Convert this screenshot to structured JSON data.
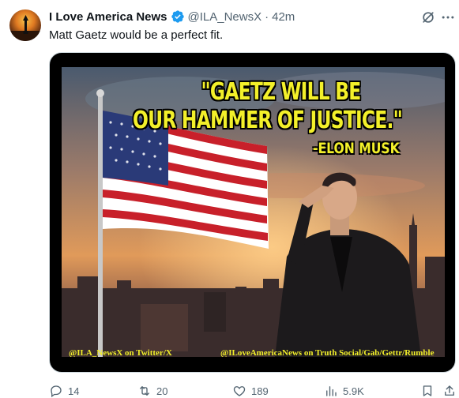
{
  "tweet": {
    "author_name": "I Love America News",
    "handle": "@ILA_NewsX",
    "separator": "·",
    "time": "42m",
    "text": "Matt Gaetz would be a perfect fit."
  },
  "image": {
    "quote_line1": "\"GAETZ WILL BE",
    "quote_line2": "OUR HAMMER OF JUSTICE.\"",
    "attribution": "-ELON MUSK",
    "watermark_left": "@ILA_NewsX on Twitter/X",
    "watermark_right": "@ILoveAmericaNews on Truth Social/Gab/Gettr/Rumble"
  },
  "actions": {
    "replies": "14",
    "retweets": "20",
    "likes": "189",
    "views": "5.9K"
  },
  "colors": {
    "verified": "#1d9bf0",
    "text_secondary": "#536471",
    "quote_yellow": "#f3f02a"
  },
  "icons": [
    "verified-badge-icon",
    "grok-icon",
    "more-icon",
    "reply-icon",
    "retweet-icon",
    "like-icon",
    "views-icon",
    "bookmark-icon",
    "share-icon"
  ]
}
